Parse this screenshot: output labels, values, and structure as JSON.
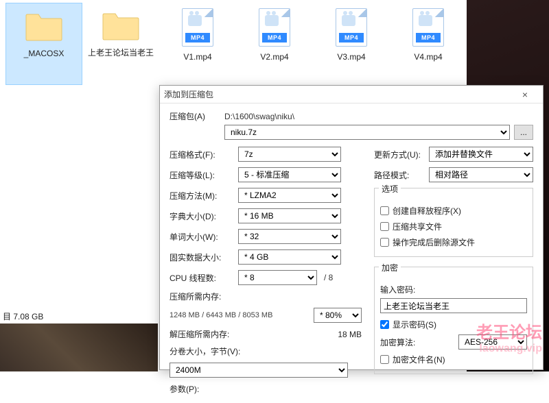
{
  "explorer": {
    "files": [
      {
        "name": "_MACOSX",
        "type": "folder",
        "selected": true
      },
      {
        "name": "上老王论坛当老王",
        "type": "folder"
      },
      {
        "name": "V1.mp4",
        "type": "mp4"
      },
      {
        "name": "V2.mp4",
        "type": "mp4"
      },
      {
        "name": "V3.mp4",
        "type": "mp4"
      },
      {
        "name": "V4.mp4",
        "type": "mp4"
      }
    ],
    "status": "目  7.08 GB",
    "mp4_badge": "MP4"
  },
  "dialog": {
    "title": "添加到压缩包",
    "archive_label": "压缩包(A)",
    "path": "D:\\1600\\swag\\niku\\",
    "archive_name": "niku.7z",
    "browse": "...",
    "left": {
      "format_label": "压缩格式(F):",
      "format": "7z",
      "level_label": "压缩等级(L):",
      "level": "5 - 标准压缩",
      "method_label": "压缩方法(M):",
      "method": "* LZMA2",
      "dict_label": "字典大小(D):",
      "dict": "* 16 MB",
      "word_label": "单词大小(W):",
      "word": "* 32",
      "solid_label": "固实数据大小:",
      "solid": "* 4 GB",
      "threads_label": "CPU 线程数:",
      "threads": "* 8",
      "threads_max": "/ 8",
      "compmem_label": "压缩所需内存:",
      "compmem_info": "1248 MB / 6443 MB / 8053 MB",
      "compmem_pct": "* 80%",
      "decompmem_label": "解压缩所需内存:",
      "decompmem_val": "18 MB",
      "split_label": "分卷大小，字节(V):",
      "split_value": "2400M",
      "params_label": "参数(P):"
    },
    "right": {
      "update_label": "更新方式(U):",
      "update": "添加并替换文件",
      "pathmode_label": "路径模式:",
      "pathmode": "相对路径",
      "options_title": "选项",
      "opt_sfx": "创建自释放程序(X)",
      "opt_share": "压缩共享文件",
      "opt_delete": "操作完成后删除源文件",
      "enc_title": "加密",
      "pw_label": "输入密码:",
      "pw_value": "上老王论坛当老王",
      "show_pw": "显示密码(S)",
      "alg_label": "加密算法:",
      "alg": "AES-256",
      "enc_names": "加密文件名(N)"
    }
  },
  "watermark": {
    "line1": "老王论坛",
    "line2": "laowang.vip"
  }
}
